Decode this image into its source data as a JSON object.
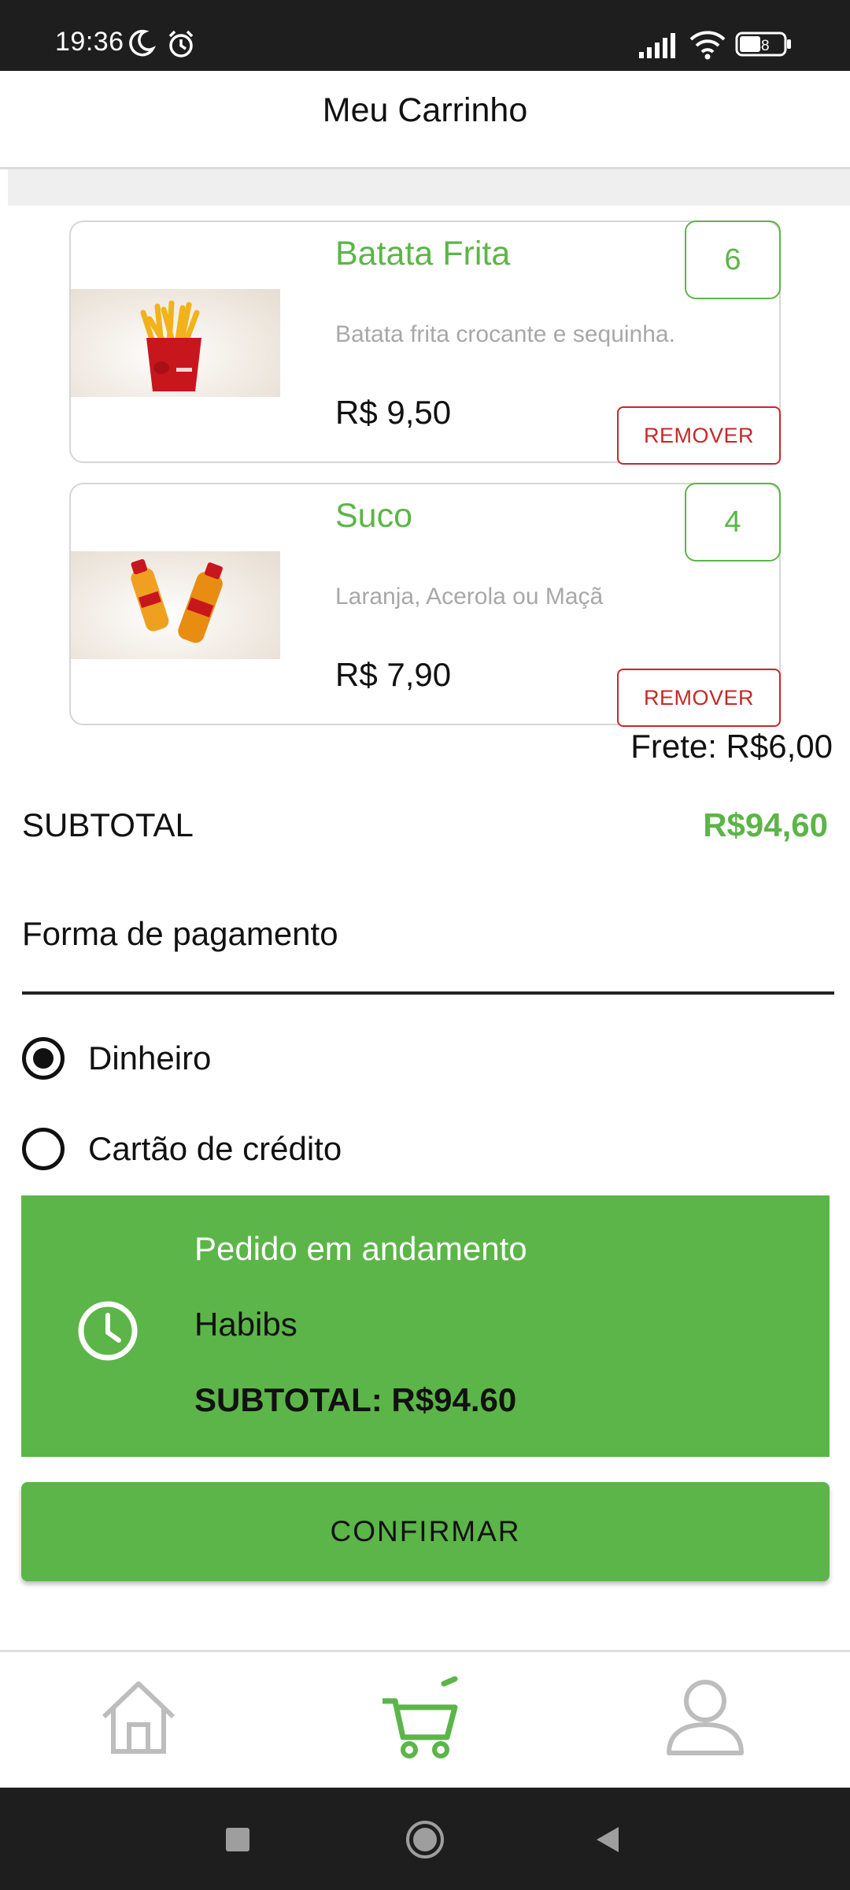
{
  "status_bar": {
    "time": "19:36",
    "battery": "48",
    "icons": [
      "moon-icon",
      "alarm-icon",
      "signal-icon",
      "wifi-icon",
      "battery-icon"
    ]
  },
  "app_bar": {
    "title": "Meu Carrinho"
  },
  "cart": {
    "items": [
      {
        "name": "Batata Frita",
        "description": "Batata frita crocante e sequinha.",
        "price": "R$ 9,50",
        "quantity": "6",
        "remove_label": "REMOVER",
        "image": "fries-image"
      },
      {
        "name": "Suco",
        "description": "Laranja, Acerola ou Maçã",
        "price": "R$ 7,90",
        "quantity": "4",
        "remove_label": "REMOVER",
        "image": "juice-bottles-image"
      }
    ],
    "frete": "Frete: R$6,00",
    "subtotal_label": "SUBTOTAL",
    "subtotal_value": "R$94,60"
  },
  "payment": {
    "title": "Forma de pagamento",
    "options": [
      {
        "label": "Dinheiro",
        "selected": true
      },
      {
        "label": "Cartão de crédito",
        "selected": false
      }
    ]
  },
  "order_status": {
    "icon": "clock-icon",
    "title": "Pedido em andamento",
    "store": "Habibs",
    "subtotal": "SUBTOTAL: R$94.60"
  },
  "confirm_label": "CONFIRMAR",
  "bottom_nav": {
    "items": [
      {
        "icon": "home-icon",
        "active": false
      },
      {
        "icon": "cart-icon",
        "active": true
      },
      {
        "icon": "profile-icon",
        "active": false
      }
    ]
  },
  "system_nav": [
    "recents-button",
    "home-button",
    "back-button"
  ],
  "colors": {
    "accent": "#5cb548",
    "remove": "#c62828",
    "muted_text": "#a8a8a8",
    "system_bar": "#1e1e1e"
  }
}
